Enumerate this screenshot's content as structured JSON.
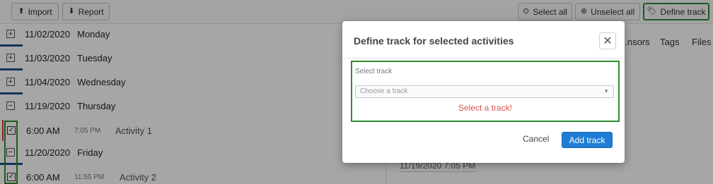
{
  "toolbar": {
    "import_label": "Import",
    "report_label": "Report",
    "select_all_label": "Select all",
    "unselect_all_label": "Unselect all",
    "define_track_label": "Define track"
  },
  "activity_list": {
    "groups": [
      {
        "date": "11/02/2020",
        "weekday": "Monday"
      },
      {
        "date": "11/03/2020",
        "weekday": "Tuesday"
      },
      {
        "date": "11/04/2020",
        "weekday": "Wednesday"
      },
      {
        "date": "11/19/2020",
        "weekday": "Thursday"
      },
      {
        "date": "11/20/2020",
        "weekday": "Friday"
      }
    ],
    "activities": [
      {
        "start": "6:00 AM",
        "end": "7:05 PM",
        "name": "Activity 1"
      },
      {
        "start": "6:00 AM",
        "end": "11:55 PM",
        "name": "Activity 2"
      }
    ]
  },
  "right_pane": {
    "tabs": [
      "...nsors",
      "Tags",
      "Files"
    ],
    "date_field": "11/19/2020 7:05 PM"
  },
  "modal": {
    "title": "Define track for selected activities",
    "field_label": "Select track",
    "select_placeholder": "Choose a track",
    "error": "Select a track!",
    "cancel_label": "Cancel",
    "submit_label": "Add track"
  },
  "colors": {
    "accent_blue": "#1f7ed4",
    "highlight_green": "#2e8b2e",
    "error_red": "#d9534f",
    "day_underline": "#1f4e85"
  }
}
